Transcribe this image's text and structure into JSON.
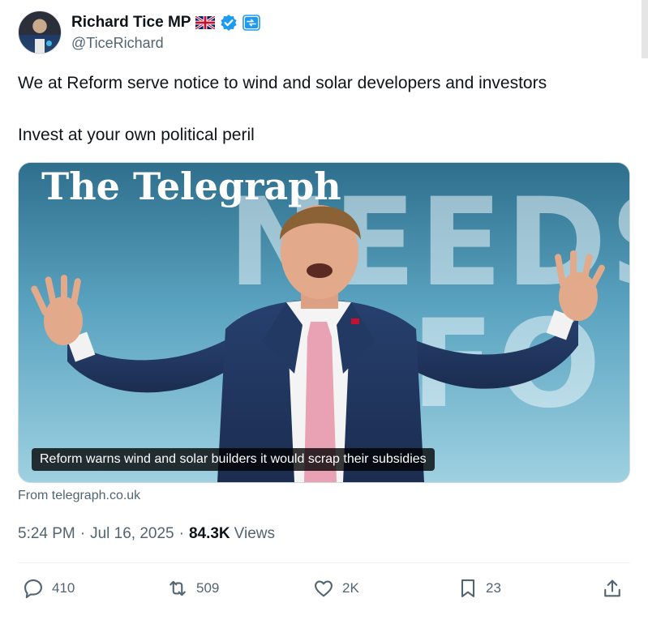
{
  "author": {
    "display_name": "Richard Tice MP",
    "handle": "@TiceRichard",
    "flag_icon": "uk-flag-icon",
    "verified_icon": "verified-badge-icon",
    "affiliate_icon": "affiliate-badge-icon"
  },
  "tweet": {
    "line1": "We at Reform serve notice to wind and solar developers and investors",
    "line2": "Invest at your own political peril"
  },
  "card": {
    "masthead": "The Telegraph",
    "background_text": "NEEDS\nREFO",
    "caption": "Reform warns wind and solar builders it would scrap their subsidies",
    "source": "From telegraph.co.uk"
  },
  "meta": {
    "time": "5:24 PM",
    "separator1": "·",
    "date": "Jul 16, 2025",
    "separator2": "·",
    "views_count": "84.3K",
    "views_label": "Views"
  },
  "actions": {
    "replies": "410",
    "reposts": "509",
    "likes": "2K",
    "bookmarks": "23"
  },
  "colors": {
    "text_primary": "#0f1419",
    "text_secondary": "#536471",
    "verified": "#1d9bf0",
    "affiliate": "#1d9bf0"
  }
}
